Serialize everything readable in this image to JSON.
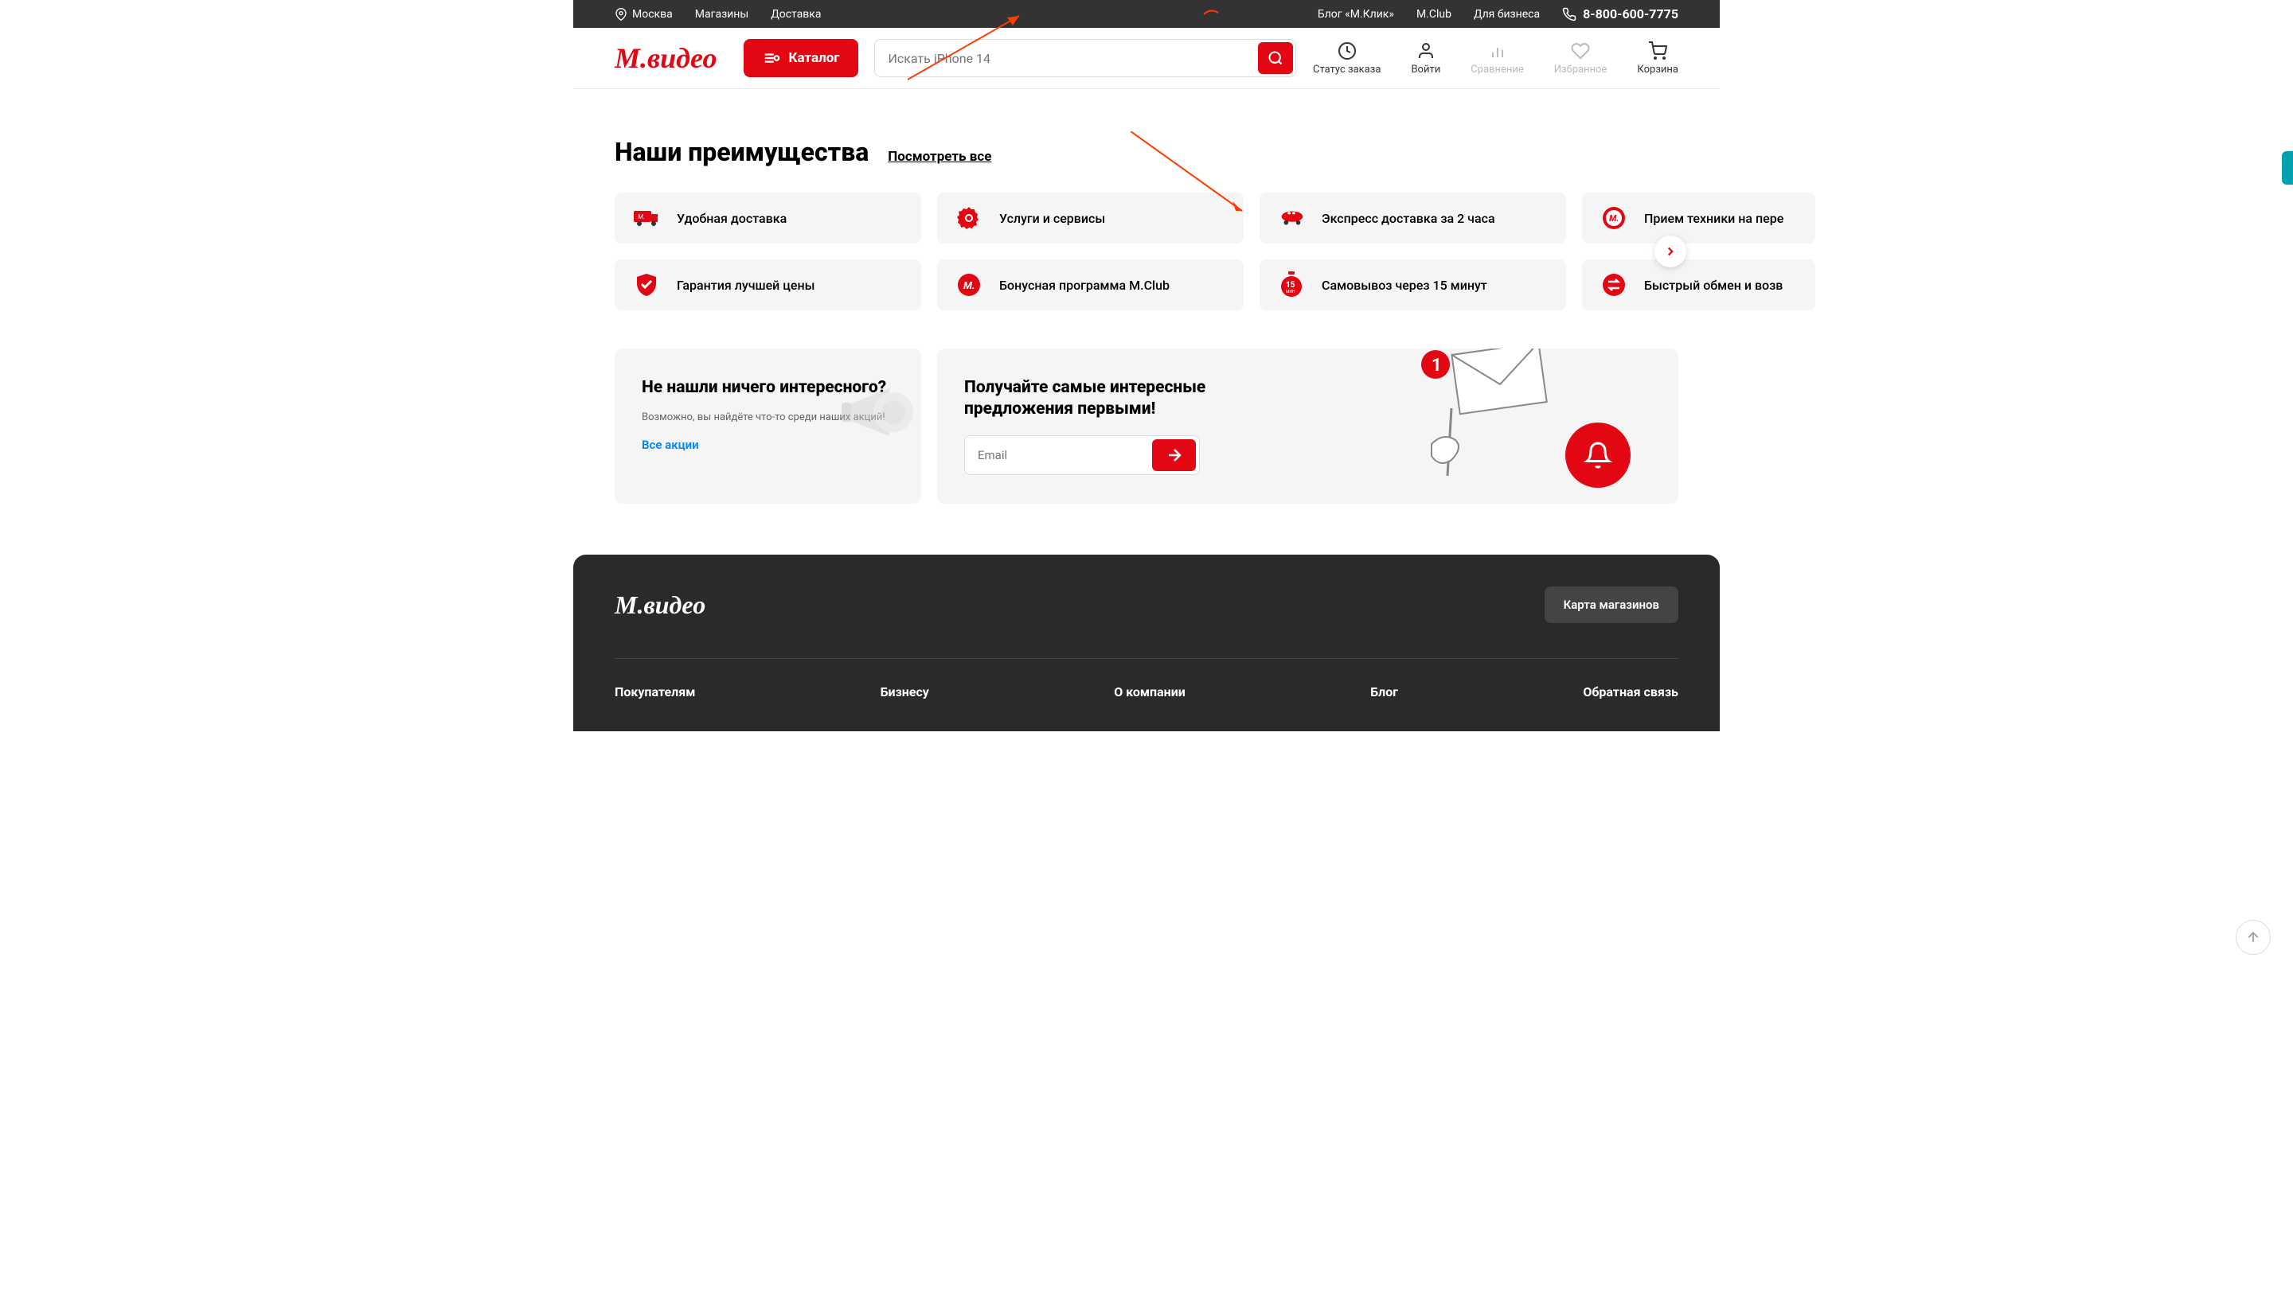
{
  "topbar": {
    "city": "Москва",
    "stores": "Магазины",
    "delivery": "Доставка",
    "blog": "Блог «М.Клик»",
    "mclub": "M.Club",
    "business": "Для бизнеса",
    "phone": "8-800-600-7775"
  },
  "header": {
    "logo": "М.видео",
    "catalog": "Каталог",
    "search_placeholder": "Искать iPhone 14",
    "status": "Статус заказа",
    "login": "Войти",
    "compare": "Сравнение",
    "favorites": "Избранное",
    "cart": "Корзина"
  },
  "advantages": {
    "title": "Наши преимущества",
    "see_all": "Посмотреть все",
    "items": [
      {
        "label": "Удобная доставка"
      },
      {
        "label": "Услуги и сервисы"
      },
      {
        "label": "Экспресс доставка за 2 часа"
      },
      {
        "label": "Прием техники на пере"
      },
      {
        "label": "Гарантия лучшей цены"
      },
      {
        "label": "Бонусная программа M.Club"
      },
      {
        "label": "Самовывоз через 15 минут"
      },
      {
        "label": "Быстрый обмен и возв"
      }
    ]
  },
  "promo": {
    "notfound_title": "Не нашли ничего интересного?",
    "notfound_sub": "Возможно, вы найдёте что-то среди наших акций!",
    "notfound_link": "Все акции",
    "subscribe_title": "Получайте самые интересные предложения первыми!",
    "email_placeholder": "Email",
    "badge": "1"
  },
  "footer": {
    "logo": "М.видео",
    "map_btn": "Карта магазинов",
    "cols": [
      "Покупателям",
      "Бизнесу",
      "О компании",
      "Блог",
      "Обратная связь"
    ]
  }
}
